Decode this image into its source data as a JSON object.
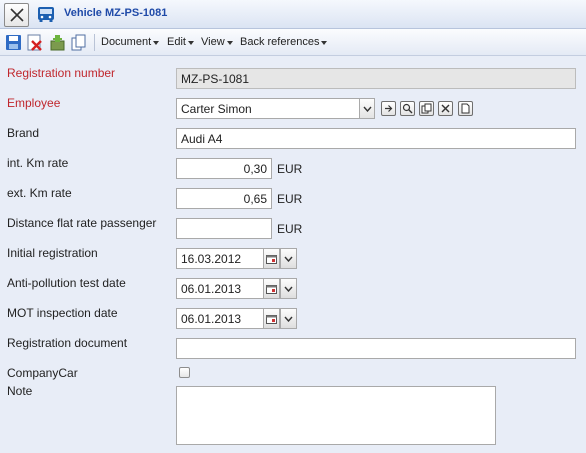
{
  "window": {
    "title": "Vehicle MZ-PS-1081"
  },
  "toolbar": {
    "icons": [
      "save-icon",
      "delete-icon",
      "add-icon",
      "copy-icon"
    ],
    "menus": [
      {
        "label": "Document"
      },
      {
        "label": "Edit"
      },
      {
        "label": "View"
      },
      {
        "label": "Back references"
      }
    ]
  },
  "form": {
    "registration_number": {
      "label": "Registration number",
      "value": "MZ-PS-1081",
      "required": true
    },
    "employee": {
      "label": "Employee",
      "value": "Carter Simon",
      "required": true,
      "action_icons": [
        "goto-icon",
        "search-icon",
        "copy-icon",
        "clear-icon",
        "new-icon"
      ]
    },
    "brand": {
      "label": "Brand",
      "value": "Audi A4"
    },
    "int_km_rate": {
      "label": "int. Km rate",
      "value": "0,30",
      "unit": "EUR"
    },
    "ext_km_rate": {
      "label": "ext. Km rate",
      "value": "0,65",
      "unit": "EUR"
    },
    "distance_flat_rate": {
      "label": "Distance flat rate passenger",
      "value": "",
      "unit": "EUR"
    },
    "initial_registration": {
      "label": "Initial registration",
      "value": "16.03.2012"
    },
    "anti_pollution_date": {
      "label": "Anti-pollution test date",
      "value": "06.01.2013"
    },
    "mot_inspection_date": {
      "label": "MOT inspection date",
      "value": "06.01.2013"
    },
    "registration_document": {
      "label": "Registration document",
      "value": ""
    },
    "company_car": {
      "label": "CompanyCar",
      "checked": false
    },
    "note": {
      "label": "Note",
      "value": ""
    }
  },
  "colors": {
    "required_label": "#c0272d",
    "title": "#1f4aa8",
    "background": "#e8edf7"
  }
}
